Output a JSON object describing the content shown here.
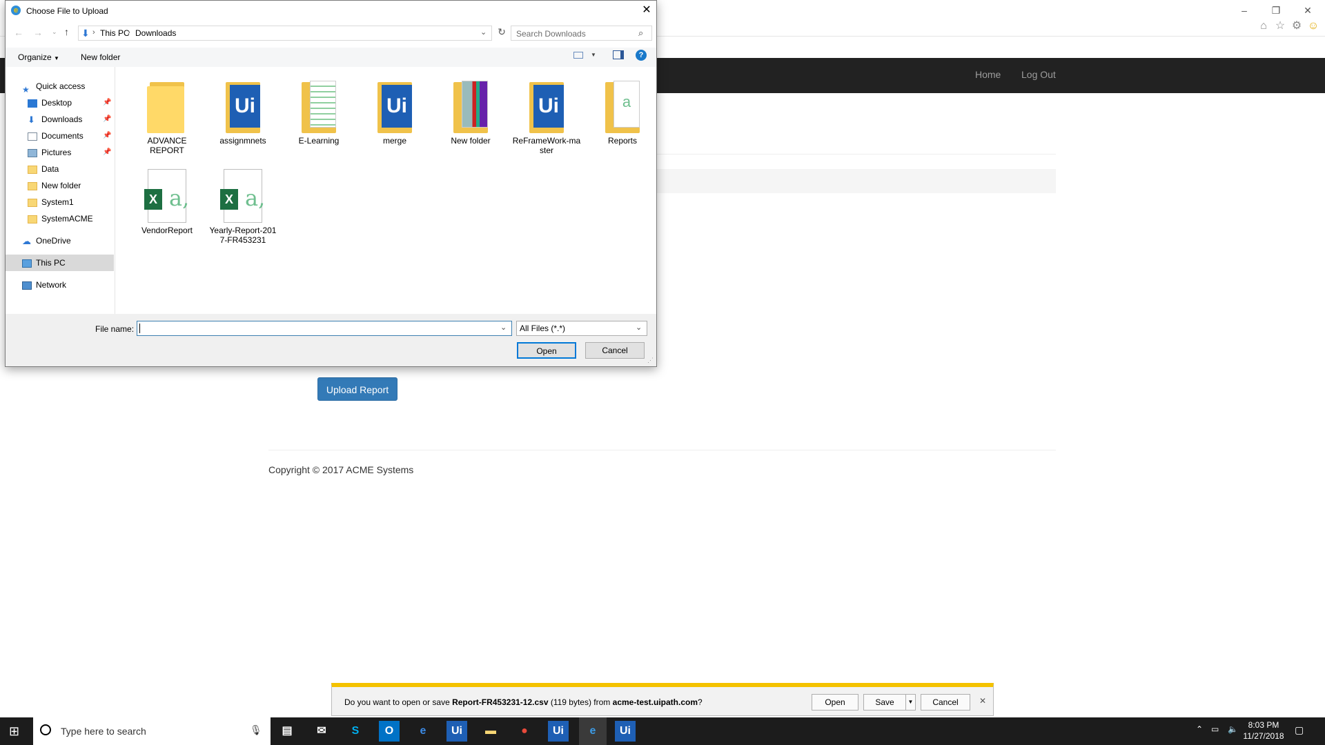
{
  "browser": {
    "nav_links": [
      "Home",
      "Log Out"
    ],
    "upload_button": "Upload Report",
    "copyright": "Copyright © 2017 ACME Systems"
  },
  "dialog": {
    "title": "Choose File to Upload",
    "breadcrumb": [
      "This PC",
      "Downloads"
    ],
    "search_placeholder": "Search Downloads",
    "toolbar": {
      "organize": "Organize",
      "new_folder": "New folder"
    },
    "nav_items": [
      {
        "label": "Quick access",
        "icon": "star-icon"
      },
      {
        "label": "Desktop",
        "icon": "desktop-icon",
        "pinned": true
      },
      {
        "label": "Downloads",
        "icon": "download-arrow-icon",
        "pinned": true
      },
      {
        "label": "Documents",
        "icon": "documents-icon",
        "pinned": true
      },
      {
        "label": "Pictures",
        "icon": "pictures-icon",
        "pinned": true
      },
      {
        "label": "Data",
        "icon": "folder-icon"
      },
      {
        "label": "New folder",
        "icon": "folder-icon"
      },
      {
        "label": "System1",
        "icon": "folder-icon"
      },
      {
        "label": "SystemACME",
        "icon": "folder-icon"
      },
      {
        "label": "OneDrive",
        "icon": "cloud-icon"
      },
      {
        "label": "This PC",
        "icon": "computer-icon",
        "selected": true
      },
      {
        "label": "Network",
        "icon": "network-icon"
      }
    ],
    "files": [
      {
        "name": "ADVANCE REPORT",
        "kind": "folder"
      },
      {
        "name": "assignmnets",
        "kind": "uipath-folder"
      },
      {
        "name": "E-Learning",
        "kind": "folder-sheet"
      },
      {
        "name": "merge",
        "kind": "uipath-folder"
      },
      {
        "name": "New folder",
        "kind": "folder-image"
      },
      {
        "name": "ReFrameWork-master",
        "kind": "uipath-folder"
      },
      {
        "name": "Reports",
        "kind": "folder-doc"
      },
      {
        "name": "VendorReport",
        "kind": "excel"
      },
      {
        "name": "Yearly-Report-2017-FR453231",
        "kind": "excel"
      }
    ],
    "file_name_label": "File name:",
    "file_name_value": "",
    "file_type": "All Files (*.*)",
    "open_button": "Open",
    "cancel_button": "Cancel"
  },
  "download_bar": {
    "prefix": "Do you want to open or save ",
    "filename": "Report-FR453231-12.csv",
    "size": " (119 bytes) from ",
    "host": "acme-test.uipath.com",
    "suffix": "?",
    "open": "Open",
    "save": "Save",
    "cancel": "Cancel"
  },
  "taskbar": {
    "search_placeholder": "Type here to search",
    "time": "8:03 PM",
    "date": "11/27/2018"
  }
}
